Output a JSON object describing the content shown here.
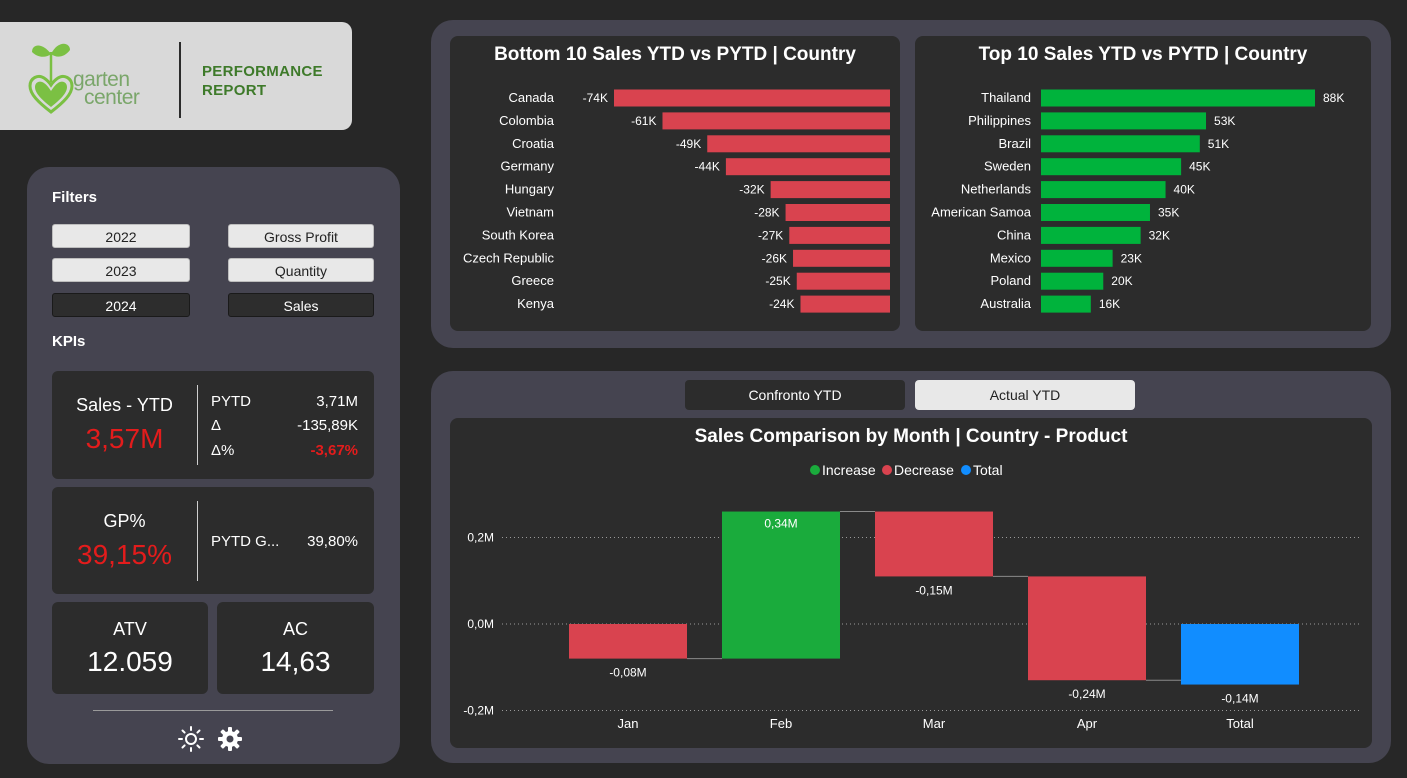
{
  "header": {
    "brand_line1": "garten",
    "brand_line2": "center",
    "title_line1": "PERFORMANCE",
    "title_line2": "REPORT"
  },
  "filters": {
    "title": "Filters",
    "years": [
      "2022",
      "2023",
      "2024"
    ],
    "metrics": [
      "Gross Profit",
      "Quantity",
      "Sales"
    ],
    "selected_year": "2024",
    "selected_metric": "Sales"
  },
  "kpis": {
    "title": "KPIs",
    "sales": {
      "label": "Sales - YTD",
      "value": "3,57M",
      "pytd_label": "PYTD",
      "pytd_value": "3,71M",
      "delta_label": "Δ",
      "delta_value": "-135,89K",
      "delta_pct_label": "Δ%",
      "delta_pct_value": "-3,67%"
    },
    "gp": {
      "label": "GP%",
      "value": "39,15%",
      "pytd_label": "PYTD G...",
      "pytd_value": "39,80%"
    },
    "atv": {
      "label": "ATV",
      "value": "12.059"
    },
    "ac": {
      "label": "AC",
      "value": "14,63"
    }
  },
  "icons": {
    "theme": "sun-icon",
    "settings": "gear-icon"
  },
  "toggles": {
    "compare": "Confronto YTD",
    "actual": "Actual YTD"
  },
  "colors": {
    "decrease": "#d9434f",
    "increase": "#1aab3c",
    "top_bar": "#00b33c",
    "total": "#118dff",
    "panel": "#454450",
    "card": "#2c2c2c",
    "negative_text": "#e31c1c"
  },
  "chart_data": [
    {
      "type": "bar",
      "orientation": "horizontal",
      "title": "Bottom 10 Sales YTD vs PYTD | Country",
      "categories": [
        "Canada",
        "Colombia",
        "Croatia",
        "Germany",
        "Hungary",
        "Vietnam",
        "South Korea",
        "Czech Republic",
        "Greece",
        "Kenya"
      ],
      "values": [
        -74,
        -61,
        -49,
        -44,
        -32,
        -28,
        -27,
        -26,
        -25,
        -24
      ],
      "labels": [
        "-74K",
        "-61K",
        "-49K",
        "-44K",
        "-32K",
        "-28K",
        "-27K",
        "-26K",
        "-25K",
        "-24K"
      ],
      "unit": "K",
      "color": "#d9434f"
    },
    {
      "type": "bar",
      "orientation": "horizontal",
      "title": "Top 10 Sales YTD vs PYTD | Country",
      "categories": [
        "Thailand",
        "Philippines",
        "Brazil",
        "Sweden",
        "Netherlands",
        "American Samoa",
        "China",
        "Mexico",
        "Poland",
        "Australia"
      ],
      "values": [
        88,
        53,
        51,
        45,
        40,
        35,
        32,
        23,
        20,
        16
      ],
      "labels": [
        "88K",
        "53K",
        "51K",
        "45K",
        "40K",
        "35K",
        "32K",
        "23K",
        "20K",
        "16K"
      ],
      "unit": "K",
      "color": "#00b33c"
    },
    {
      "type": "bar",
      "subtype": "waterfall",
      "title": "Sales Comparison by Month | Country - Product",
      "legend": [
        "Increase",
        "Decrease",
        "Total"
      ],
      "legend_placement": "top-center",
      "categories": [
        "Jan",
        "Feb",
        "Mar",
        "Apr",
        "Total"
      ],
      "values": [
        -0.08,
        0.34,
        -0.15,
        -0.24,
        -0.14
      ],
      "labels": [
        "-0,08M",
        "0,34M",
        "-0,15M",
        "-0,24M",
        "-0,14M"
      ],
      "kinds": [
        "Decrease",
        "Increase",
        "Decrease",
        "Decrease",
        "Total"
      ],
      "y_ticks": [
        "0,2M",
        "0,0M",
        "-0,2M"
      ],
      "y_tick_values": [
        0.2,
        0.0,
        -0.2
      ],
      "ylim": [
        -0.2,
        0.28
      ],
      "grid": true
    }
  ]
}
